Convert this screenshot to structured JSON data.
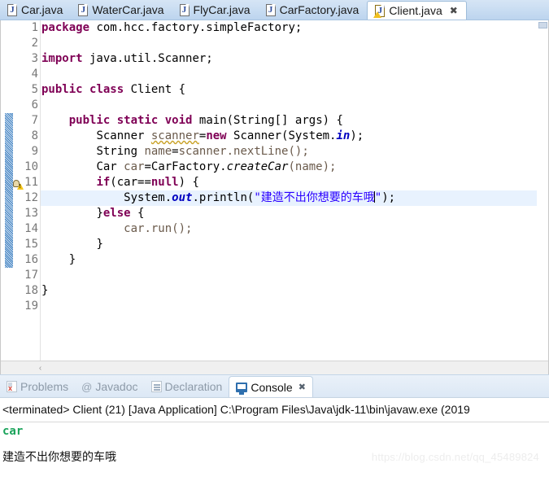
{
  "editor_tabs": [
    {
      "label": "Car.java",
      "icon": "java-file-icon",
      "active": false,
      "closable": false
    },
    {
      "label": "WaterCar.java",
      "icon": "java-file-icon",
      "active": false,
      "closable": false
    },
    {
      "label": "FlyCar.java",
      "icon": "java-file-icon",
      "active": false,
      "closable": false
    },
    {
      "label": "CarFactory.java",
      "icon": "java-file-icon",
      "active": false,
      "closable": false
    },
    {
      "label": "Client.java",
      "icon": "java-file-warning-icon",
      "active": true,
      "closable": true,
      "close_glyph": "✖"
    }
  ],
  "editor": {
    "line_numbers": [
      "1",
      "2",
      "3",
      "4",
      "5",
      "6",
      "7",
      "8",
      "9",
      "10",
      "11",
      "12",
      "13",
      "14",
      "15",
      "16",
      "17",
      "18",
      "19"
    ],
    "highlighted_line": 12,
    "changed_lines_from": 7,
    "changed_lines_to": 16,
    "quickfix_marker_line": 8,
    "caret_line": 12,
    "lines": [
      {
        "n": 1,
        "text": "package com.hcc.factory.simpleFactory;"
      },
      {
        "n": 2,
        "text": ""
      },
      {
        "n": 3,
        "text": "import java.util.Scanner;"
      },
      {
        "n": 4,
        "text": ""
      },
      {
        "n": 5,
        "text": "public class Client {"
      },
      {
        "n": 6,
        "text": ""
      },
      {
        "n": 7,
        "text": "    public static void main(String[] args) {"
      },
      {
        "n": 8,
        "text": "        Scanner scanner=new Scanner(System.in);"
      },
      {
        "n": 9,
        "text": "        String name=scanner.nextLine();"
      },
      {
        "n": 10,
        "text": "        Car car=CarFactory.createCar(name);"
      },
      {
        "n": 11,
        "text": "        if(car==null) {"
      },
      {
        "n": 12,
        "text": "            System.out.println(\"建造不出你想要的车哦\");"
      },
      {
        "n": 13,
        "text": "        }else {"
      },
      {
        "n": 14,
        "text": "            car.run();"
      },
      {
        "n": 15,
        "text": "        }"
      },
      {
        "n": 16,
        "text": "    }"
      },
      {
        "n": 17,
        "text": ""
      },
      {
        "n": 18,
        "text": "}"
      },
      {
        "n": 19,
        "text": ""
      }
    ],
    "tokens": {
      "kw_package": "package",
      "pkg_name": " com.hcc.factory.simpleFactory;",
      "kw_import": "import",
      "import_name": " java.util.Scanner;",
      "kw_public": "public",
      "kw_class": "class",
      "class_name": "Client {",
      "kw_static": "static",
      "kw_void": "void",
      "main_sig": "main(String[] args) {",
      "type_scanner": "Scanner ",
      "var_scanner": "scanner",
      "eq": "=",
      "kw_new": "new",
      "scanner_ctor": " Scanner(System.",
      "field_in": "in",
      "close_paren_semi": ");",
      "type_string": "String ",
      "var_name": "name",
      "next_line_call": "scanner.nextLine();",
      "type_car": "Car ",
      "var_car": "car",
      "factory": "CarFactory.",
      "static_create": "createCar",
      "create_args": "(name);",
      "kw_if": "if",
      "if_cond_open": "(car==",
      "kw_null": "null",
      "if_cond_close": ") {",
      "sysout_prefix": "System.",
      "field_out": "out",
      "println_open": ".println(",
      "quote": "\"",
      "chinese_message": "建造不出你想要的车哦",
      "println_close": ");",
      "brace_close": "}",
      "kw_else": "else",
      "else_open": " {",
      "car_run": "car.run();",
      "indent4": "    ",
      "indent8": "        ",
      "indent12": "            "
    },
    "hscroll_left_arrow": "‹"
  },
  "view_tabs": [
    {
      "label": "Problems",
      "icon": "problems-icon",
      "active": false,
      "closable": false
    },
    {
      "label": "Javadoc",
      "icon": "javadoc-at-icon",
      "active": false,
      "closable": false
    },
    {
      "label": "Declaration",
      "icon": "declaration-icon",
      "active": false,
      "closable": false
    },
    {
      "label": "Console",
      "icon": "console-icon",
      "active": true,
      "closable": true,
      "close_glyph": "✖"
    }
  ],
  "console": {
    "header": "<terminated> Client (21) [Java Application] C:\\Program Files\\Java\\jdk-11\\bin\\javaw.exe (2019",
    "output_input_echo": "car",
    "output_message": "建造不出你想要的车哦"
  },
  "watermark": "https://blog.csdn.net/qq_45489824",
  "colors": {
    "keyword": "#7f0055",
    "string": "#2a00ff",
    "local_var": "#6a5a4b",
    "static_field": "#0000c0",
    "line_highlight": "#e8f2fe",
    "console_echo": "#1aa35a",
    "tabbar": "#c9ddf2"
  }
}
